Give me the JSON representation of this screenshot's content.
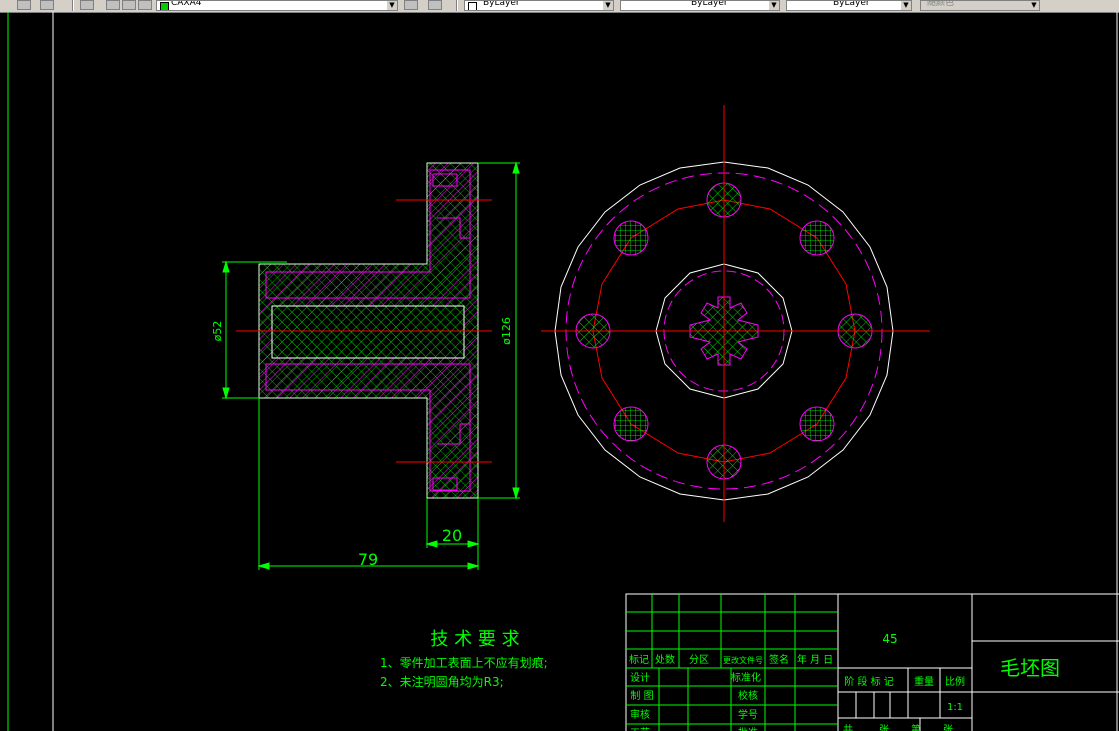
{
  "toolbar": {
    "layer_combo": "CAXA4",
    "color_combo": "ByLayer",
    "linetype_combo": "ByLayer",
    "lineweight_combo": "ByLayer",
    "plotstyle_combo": "随颜色",
    "colors": {
      "face": "#d4d0c8",
      "layer_swatch": "#00cc00"
    }
  },
  "drawing": {
    "dims": {
      "d52": "ø52",
      "d126": "ø126",
      "d20": "20",
      "d79": "79"
    },
    "tech": {
      "title": "技 术 要 求",
      "line1": "1、零件加工表面上不应有划痕;",
      "line2": "2、未注明圆角均为R3;"
    },
    "title_block": {
      "material": "45",
      "drawing_name": "毛坯图",
      "biaoji": "标记",
      "chushu": "处数",
      "fenqu": "分区",
      "gengai": "更改文件号",
      "qianming": "签名",
      "nianyueri": "年 月 日",
      "sheji": "设计",
      "biaozhunhua": "标准化",
      "zhitu": "制 图",
      "jiaohe": "校核",
      "shenhe": "审核",
      "xuehao": "学号",
      "gongyi": "工艺",
      "pizhun": "批准",
      "jieduan": "阶 段 标 记",
      "zhongliang": "重量",
      "bili": "比例",
      "scale": "1:1",
      "gong": "共",
      "zhang1": "张",
      "di": "第",
      "zhang2": "张"
    },
    "colors": {
      "background": "#000000",
      "outline": "#ffffff",
      "dimension": "#00ff00",
      "hatch_magenta": "#ff00ff",
      "centerline": "#ff0000",
      "hatch_green": "#00ff00"
    }
  }
}
